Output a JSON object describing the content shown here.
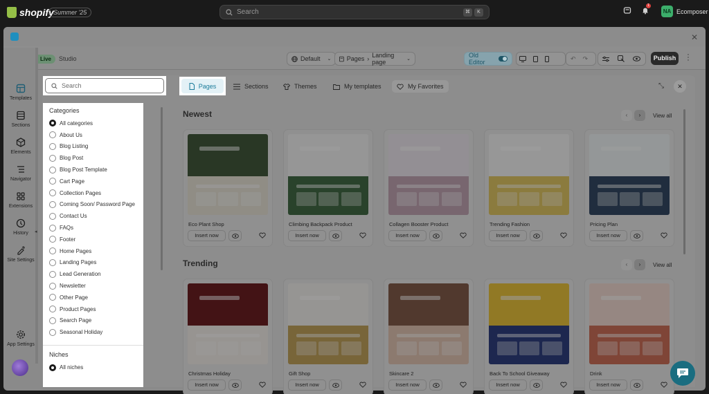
{
  "topbar": {
    "brand": "shopify",
    "edition": "Summer '25",
    "search_placeholder": "Search",
    "shortcut_keys": [
      "⌘",
      "K"
    ],
    "notification_count": "1",
    "account_initials": "NA",
    "account_name": "Ecomposer"
  },
  "toolbar": {
    "live_label": "Live",
    "studio_label": "Studio",
    "theme_select": "Default",
    "page_crumb_root": "Pages",
    "page_crumb_leaf": "Landing page",
    "old_editor_label": "Old Editor",
    "publish_label": "Publish"
  },
  "sidebar": {
    "items": [
      {
        "label": "Templates",
        "icon": "templates-icon"
      },
      {
        "label": "Sections",
        "icon": "sections-icon"
      },
      {
        "label": "Elements",
        "icon": "elements-icon"
      },
      {
        "label": "Navigator",
        "icon": "navigator-icon"
      },
      {
        "label": "Extensions",
        "icon": "extensions-icon"
      },
      {
        "label": "History",
        "icon": "history-icon"
      },
      {
        "label": "Site Settings",
        "icon": "site-settings-icon"
      }
    ],
    "app_settings": "App Settings"
  },
  "library": {
    "search_placeholder": "Search",
    "tabs": [
      {
        "label": "Pages",
        "active": true
      },
      {
        "label": "Sections"
      },
      {
        "label": "Themes"
      },
      {
        "label": "My templates"
      },
      {
        "label": "My Favorites"
      }
    ],
    "categories_title": "Categories",
    "categories": [
      "All categories",
      "About Us",
      "Blog Listing",
      "Blog Post",
      "Blog Post Template",
      "Cart Page",
      "Collection Pages",
      "Coming Soon/ Password Page",
      "Contact Us",
      "FAQs",
      "Footer",
      "Home Pages",
      "Landing Pages",
      "Lead Generation",
      "Newsletter",
      "Other Page",
      "Product Pages",
      "Search Page",
      "Seasonal Holiday"
    ],
    "selected_category": "All categories",
    "niches_title": "Niches",
    "niches": [
      "All niches"
    ],
    "insert_label": "Insert now",
    "view_all_label": "View all",
    "sections": [
      {
        "title": "Newest",
        "cards": [
          {
            "name": "Eco Plant Shop",
            "palette": [
              "#3f5a36",
              "#e9e3d4"
            ]
          },
          {
            "name": "Climbing Backpack Product",
            "palette": [
              "#f2f2f2",
              "#3b6e3f"
            ]
          },
          {
            "name": "Collagen Booster Product",
            "palette": [
              "#efe6f0",
              "#c7a3b5"
            ]
          },
          {
            "name": "Trending Fashion",
            "palette": [
              "#f4f4f4",
              "#e8c64c"
            ]
          },
          {
            "name": "Pricing Plan",
            "palette": [
              "#eef3f5",
              "#2e4a6b"
            ]
          }
        ]
      },
      {
        "title": "Trending",
        "cards": [
          {
            "name": "Christmas Holiday",
            "palette": [
              "#7b1a1f",
              "#f5efe8"
            ]
          },
          {
            "name": "Gift Shop",
            "palette": [
              "#f3f0ec",
              "#c8a24a"
            ]
          },
          {
            "name": "Skincare 2",
            "palette": [
              "#8a5a44",
              "#e7c3ad"
            ]
          },
          {
            "name": "Back To School Giveaway",
            "palette": [
              "#f3c41a",
              "#2a3f8f"
            ]
          },
          {
            "name": "Drink",
            "palette": [
              "#f7d9cf",
              "#e06a4f"
            ]
          }
        ]
      }
    ]
  },
  "colors": {
    "accent": "#1a7b9a",
    "live": "#3cae6b"
  }
}
